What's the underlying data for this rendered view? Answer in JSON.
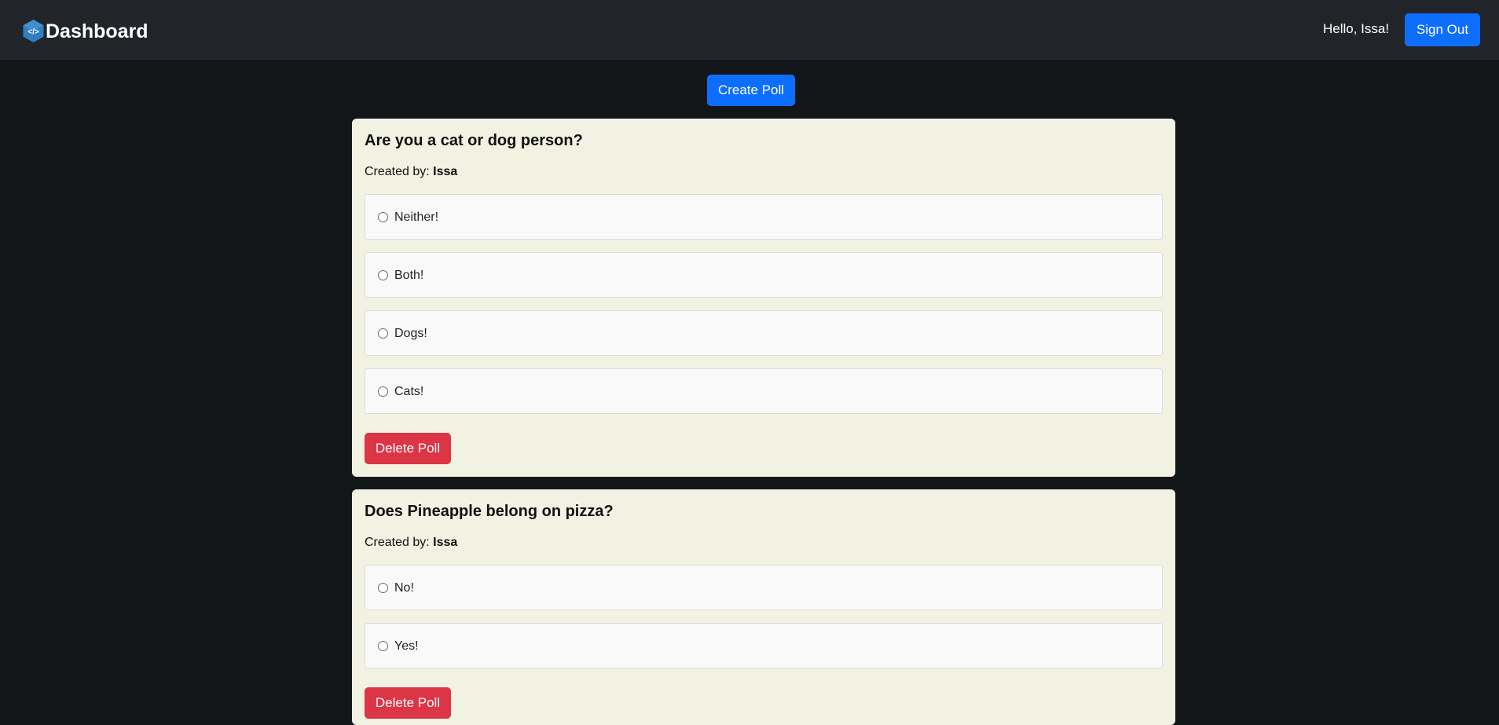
{
  "navbar": {
    "brand": "Dashboard",
    "logo_icon": "code-hexagon-icon",
    "greeting": "Hello, Issa!",
    "signout_label": "Sign Out"
  },
  "toolbar": {
    "create_poll_label": "Create Poll"
  },
  "polls": [
    {
      "question": "Are you a cat or dog person?",
      "created_by_label": "Created by:",
      "creator": "Issa",
      "options": [
        "Neither!",
        "Both!",
        "Dogs!",
        "Cats!"
      ],
      "delete_label": "Delete Poll"
    },
    {
      "question": "Does Pineapple belong on pizza?",
      "created_by_label": "Created by:",
      "creator": "Issa",
      "options": [
        "No!",
        "Yes!"
      ],
      "delete_label": "Delete Poll"
    }
  ],
  "colors": {
    "page_bg": "#121618",
    "navbar_bg": "#212529",
    "card_bg": "#f2f2e2",
    "primary": "#0d6efd",
    "danger": "#dc3545",
    "logo": "#2f7fc1"
  }
}
